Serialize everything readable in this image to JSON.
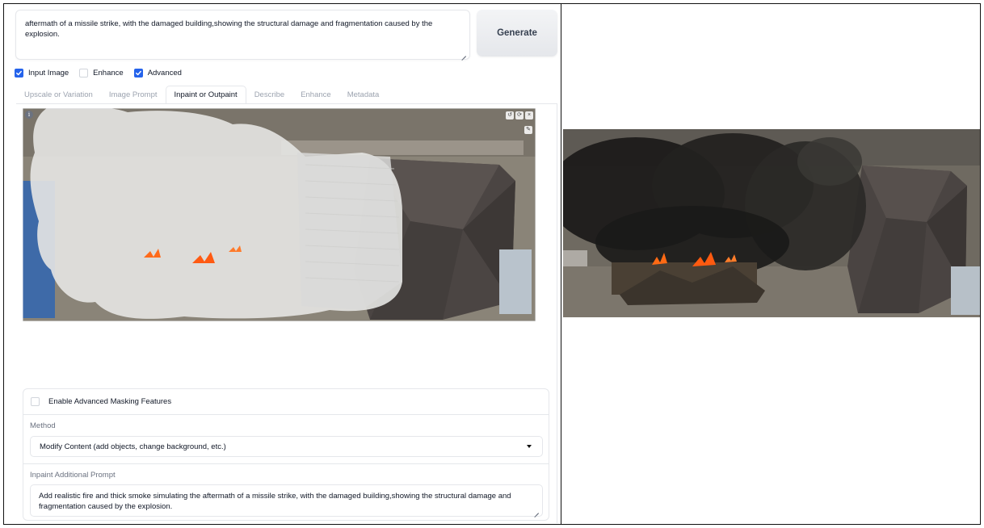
{
  "prompt": {
    "text": "aftermath of a missile strike, with the damaged building,showing the structural damage and fragmentation caused by the explosion."
  },
  "generate_button": {
    "label": "Generate"
  },
  "options": [
    {
      "label": "Input Image",
      "checked": true
    },
    {
      "label": "Enhance",
      "checked": false
    },
    {
      "label": "Advanced",
      "checked": true
    }
  ],
  "tabs": [
    {
      "label": "Upscale or Variation",
      "active": false
    },
    {
      "label": "Image Prompt",
      "active": false
    },
    {
      "label": "Inpaint or Outpaint",
      "active": true
    },
    {
      "label": "Describe",
      "active": false
    },
    {
      "label": "Enhance",
      "active": false
    },
    {
      "label": "Metadata",
      "active": false
    }
  ],
  "masking": {
    "enable_label": "Enable Advanced Masking Features",
    "enable_checked": false,
    "method_label": "Method",
    "method_value": "Modify Content (add objects, change background, etc.)",
    "additional_prompt_label": "Inpaint Additional Prompt",
    "additional_prompt_value": "Add realistic fire and thick smoke simulating the aftermath of a missile strike, with the damaged building,showing the structural damage and fragmentation caused by the explosion."
  },
  "colors": {
    "accent": "#2563eb",
    "border": "#e5e7eb",
    "muted": "#9ca3af"
  }
}
